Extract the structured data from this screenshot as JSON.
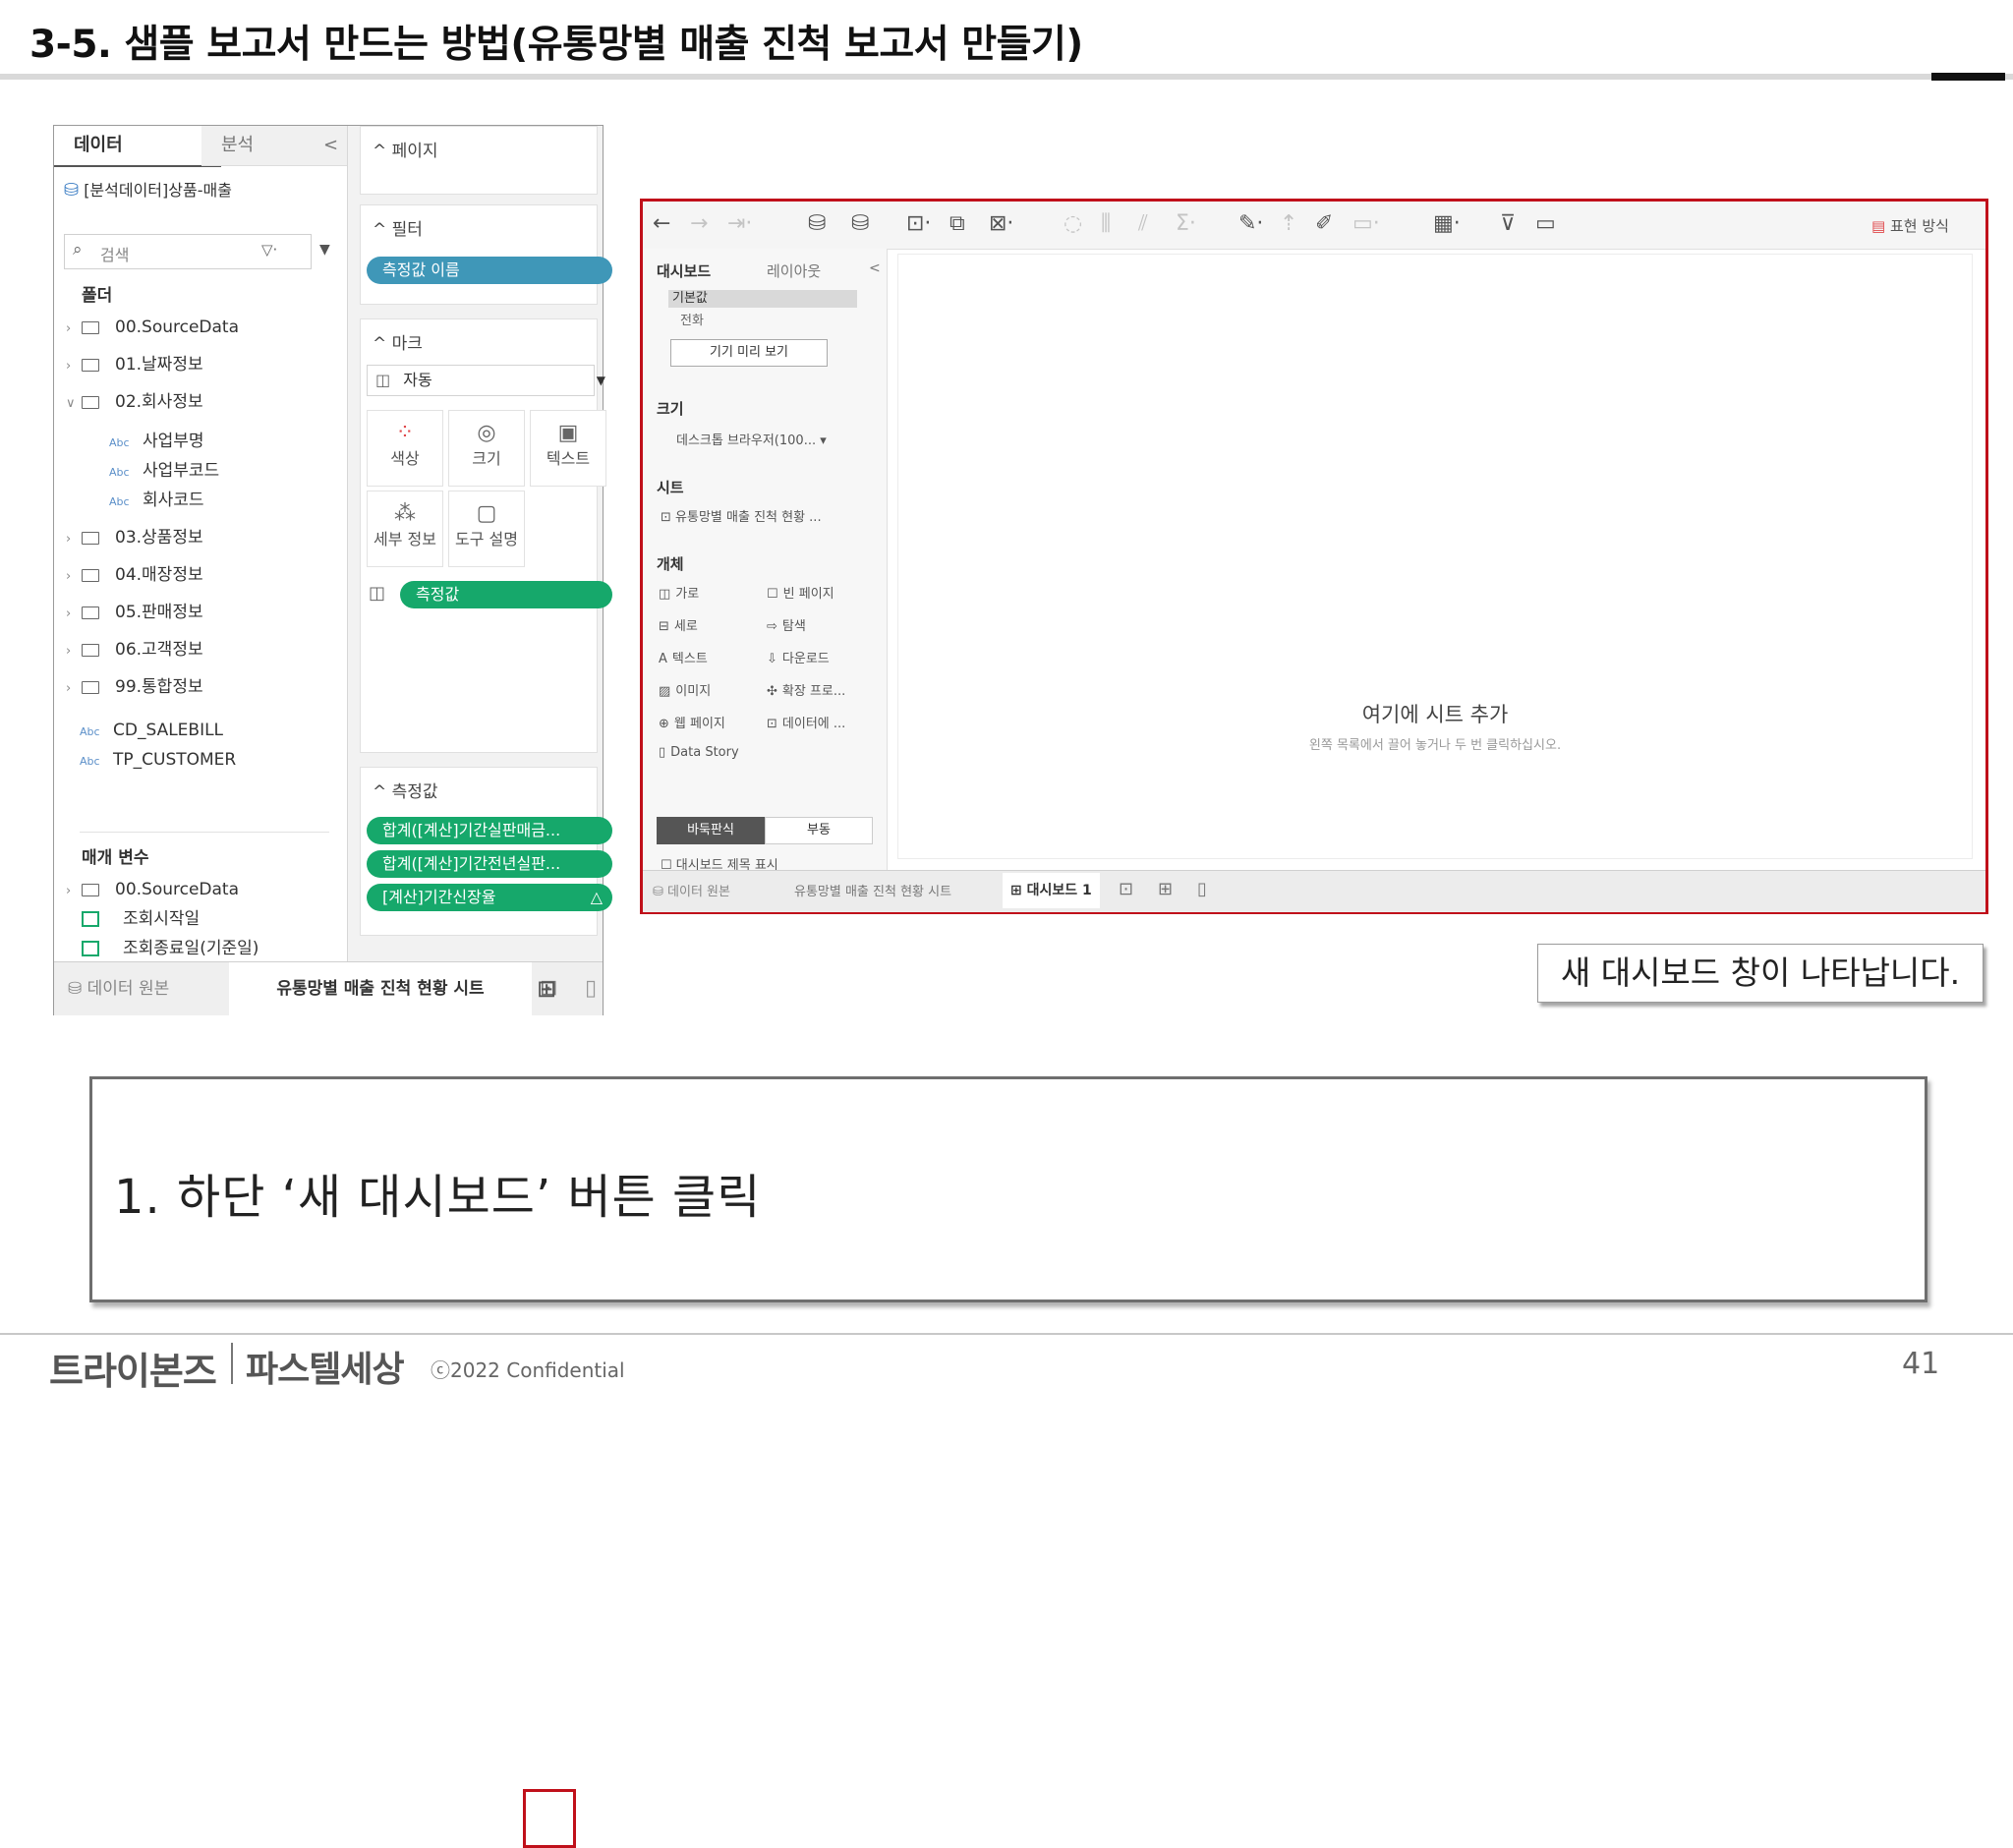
{
  "slide": {
    "title": "3-5. 샘플 보고서 만드는 방법(유통망별 매출 진척 보고서 만들기)",
    "callout": "새 대시보드 창이 나타납니다.",
    "instruction": "1.  하단 ‘새 대시보드’ 버튼 클릭",
    "footer": {
      "logo_left": "트라이본즈",
      "logo_right": "파스텔세상",
      "confidential": "ⓒ2022 Confidential",
      "page": "41"
    }
  },
  "left_window": {
    "tabs": [
      "데이터",
      "분석"
    ],
    "collapse_glyph": "<",
    "datasource": "[분석데이터]상품-매출",
    "search_placeholder": "검색",
    "folders_header": "폴더",
    "tree": [
      {
        "label": "00.SourceData",
        "type": "folder",
        "expanded": false
      },
      {
        "label": "01.날짜정보",
        "type": "folder",
        "expanded": false
      },
      {
        "label": "02.회사정보",
        "type": "folder",
        "expanded": true
      },
      {
        "label": "사업부명",
        "type": "field"
      },
      {
        "label": "사업부코드",
        "type": "field"
      },
      {
        "label": "회사코드",
        "type": "field"
      },
      {
        "label": "03.상품정보",
        "type": "folder",
        "expanded": false
      },
      {
        "label": "04.매장정보",
        "type": "folder",
        "expanded": false
      },
      {
        "label": "05.판매정보",
        "type": "folder",
        "expanded": false
      },
      {
        "label": "06.고객정보",
        "type": "folder",
        "expanded": false
      },
      {
        "label": "99.통합정보",
        "type": "folder",
        "expanded": false
      },
      {
        "label": "CD_SALEBILL",
        "type": "field"
      },
      {
        "label": "TP_CUSTOMER",
        "type": "field"
      }
    ],
    "params_header": "매개 변수",
    "params": [
      {
        "label": "00.SourceData",
        "type": "folder"
      },
      {
        "label": "조회시작일",
        "type": "param"
      },
      {
        "label": "조회종료일(기준일)",
        "type": "param"
      }
    ],
    "cards": {
      "pages": "페이지",
      "filters": "필터",
      "filter_pill": "측정값 이름",
      "marks": "마크",
      "mark_type": "자동",
      "mark_buttons": [
        "색상",
        "크기",
        "텍스트",
        "세부 정보",
        "도구 설명"
      ],
      "marks_pill": "측정값",
      "measures": "측정값",
      "measure_pills": [
        "합계([계산]기간실판매금...",
        "합계([계산]기간전년실판...",
        "[계산]기간신장율"
      ]
    },
    "bottom_tabs": {
      "datasource": "데이터 원본",
      "sheet": "유통망별 매출 진척 현황 시트"
    }
  },
  "right_window": {
    "toolbar_right": "표현 방식",
    "side_tabs": [
      "대시보드",
      "레이아웃"
    ],
    "device": {
      "default": "기본값",
      "phone": "전화",
      "preview_button": "기기 미리 보기"
    },
    "size_header": "크기",
    "size_value": "데스크톱 브라우저(100...",
    "sheets_header": "시트",
    "sheet_item": "유통망별 매출 진척 현황 ...",
    "objects_header": "개체",
    "objects": [
      {
        "label": "가로",
        "icon": "horizontal-icon"
      },
      {
        "label": "빈 페이지",
        "icon": "blank-icon"
      },
      {
        "label": "세로",
        "icon": "vertical-icon"
      },
      {
        "label": "탐색",
        "icon": "navigation-icon"
      },
      {
        "label": "텍스트",
        "icon": "text-icon"
      },
      {
        "label": "다운로드",
        "icon": "download-icon"
      },
      {
        "label": "이미지",
        "icon": "image-icon"
      },
      {
        "label": "확장 프로...",
        "icon": "extension-icon"
      },
      {
        "label": "웹 페이지",
        "icon": "web-icon"
      },
      {
        "label": "데이터에 ...",
        "icon": "data-icon"
      },
      {
        "label": "Data Story",
        "icon": "story-icon"
      }
    ],
    "layout_toggle": [
      "바둑판식",
      "부동"
    ],
    "show_title": "대시보드 제목 표시",
    "canvas_title": "여기에 시트 추가",
    "canvas_hint": "왼쪽 목록에서 끌어 놓거나 두 번 클릭하십시오.",
    "bottom_tabs": {
      "datasource": "데이터 원본",
      "sheet": "유통망별 매출 진척 현황 시트",
      "dashboard": "대시보드 1"
    }
  },
  "colors": {
    "highlight_red": "#c0101a",
    "pill_blue": "#3f97b8",
    "pill_green": "#16a86b"
  }
}
